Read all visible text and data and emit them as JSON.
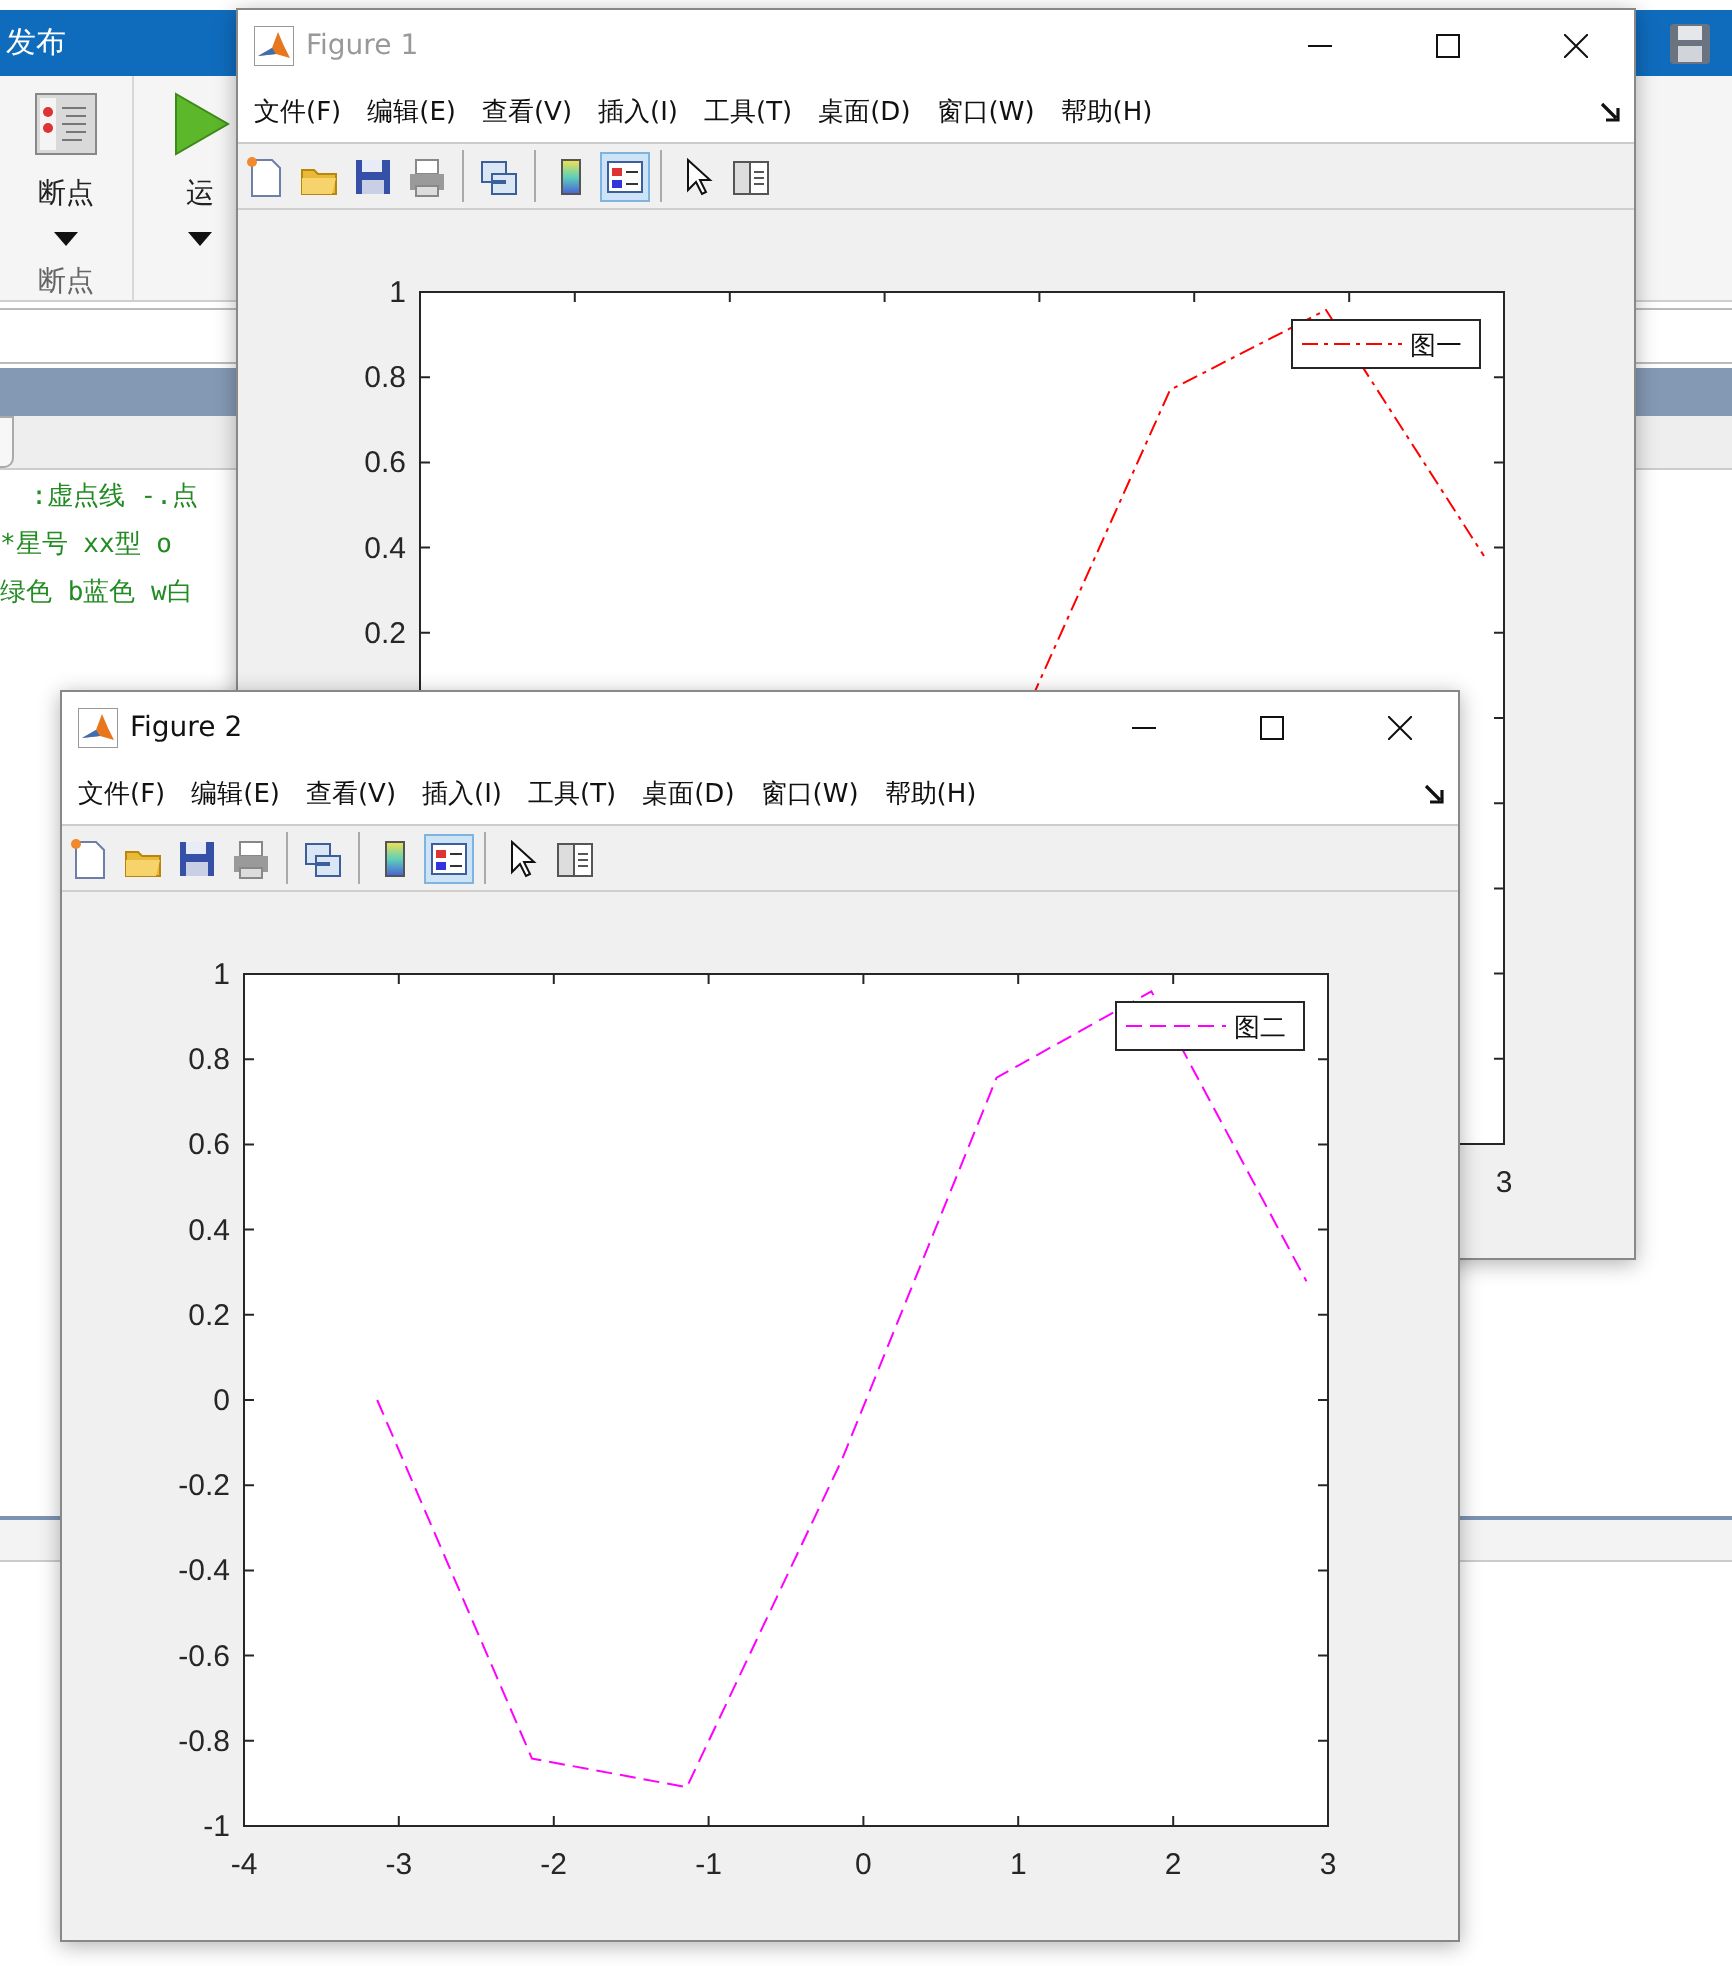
{
  "matlab": {
    "ribbon_tab": "发布",
    "breakpoints_button": "断点",
    "run_button": "运",
    "group_label": "断点",
    "code_lines": [
      "  :虚点线 -.点",
      "*星号 xx型 o",
      "绿色 b蓝色 w白"
    ]
  },
  "windows": [
    {
      "title": "Figure 1",
      "active": false,
      "menu": [
        "文件(F)",
        "编辑(E)",
        "查看(V)",
        "插入(I)",
        "工具(T)",
        "桌面(D)",
        "窗口(W)",
        "帮助(H)"
      ],
      "toolbar": [
        [
          {
            "kind": "new",
            "selected": false
          },
          {
            "kind": "open",
            "selected": false
          },
          {
            "kind": "save",
            "selected": false
          },
          {
            "kind": "print",
            "selected": false
          }
        ],
        [
          {
            "kind": "link",
            "selected": false
          }
        ],
        [
          {
            "kind": "colorbar",
            "selected": false
          },
          {
            "kind": "legend",
            "selected": true
          }
        ],
        [
          {
            "kind": "pointer",
            "selected": false
          },
          {
            "kind": "inspector",
            "selected": false
          }
        ]
      ],
      "plot": {
        "y_tick_labels": [
          "1",
          "0.8",
          "0.6",
          "0.4",
          "0.2"
        ],
        "x_tick_labels": [
          "3"
        ],
        "legend": "图一"
      }
    },
    {
      "title": "Figure 2",
      "active": true,
      "menu": [
        "文件(F)",
        "编辑(E)",
        "查看(V)",
        "插入(I)",
        "工具(T)",
        "桌面(D)",
        "窗口(W)",
        "帮助(H)"
      ],
      "toolbar": [
        [
          {
            "kind": "new",
            "selected": false
          },
          {
            "kind": "open",
            "selected": false
          },
          {
            "kind": "save",
            "selected": false
          },
          {
            "kind": "print",
            "selected": false
          }
        ],
        [
          {
            "kind": "link",
            "selected": false
          }
        ],
        [
          {
            "kind": "colorbar",
            "selected": false
          },
          {
            "kind": "legend",
            "selected": true
          }
        ],
        [
          {
            "kind": "pointer",
            "selected": false
          },
          {
            "kind": "inspector",
            "selected": false
          }
        ]
      ],
      "chart_data": {
        "type": "line",
        "x": [
          -3.14,
          -2.14,
          -1.14,
          -0.14,
          0.86,
          1.86,
          2.86
        ],
        "xlim": [
          -4,
          3
        ],
        "ylim": [
          -1,
          1
        ],
        "xticks": [
          -4,
          -3,
          -2,
          -1,
          0,
          1,
          2,
          3
        ],
        "yticks": [
          -1,
          -0.8,
          -0.6,
          -0.4,
          -0.2,
          0,
          0.2,
          0.4,
          0.6,
          0.8,
          1
        ],
        "series": [
          {
            "name": "图二",
            "color": "#ff00ff",
            "line_style": "dash",
            "values": [
              0,
              -0.842,
              -0.909,
              -0.141,
              0.757,
              0.959,
              0.279
            ]
          }
        ]
      }
    }
  ]
}
